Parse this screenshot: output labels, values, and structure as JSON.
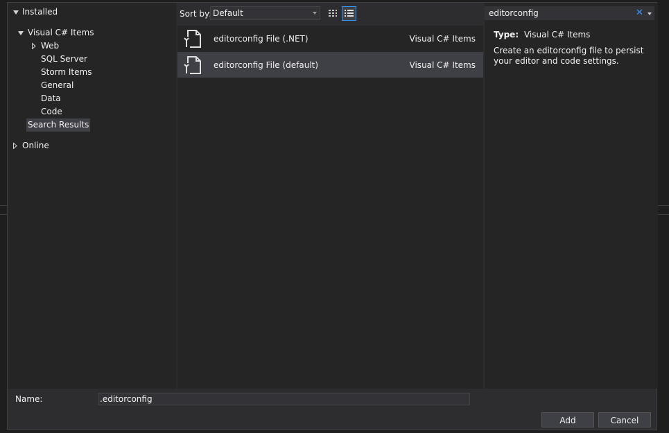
{
  "dialog": {
    "tree": {
      "installed": "Installed",
      "visual_csharp_items": "Visual C# Items",
      "children": [
        "Web",
        "SQL Server",
        "Storm Items",
        "General",
        "Data",
        "Code"
      ],
      "search_results": "Search Results",
      "online": "Online"
    },
    "toolbar": {
      "sort_label": "Sort by:",
      "sort_value": "Default"
    },
    "templates": [
      {
        "name": "editorconfig File (.NET)",
        "category": "Visual C# Items"
      },
      {
        "name": "editorconfig File (default)",
        "category": "Visual C# Items"
      }
    ],
    "search": {
      "value": "editorconfig",
      "clear_glyph": "✕"
    },
    "details": {
      "type_label": "Type:",
      "type_value": "Visual C# Items",
      "description": "Create an editorconfig file to persist your editor and code settings."
    },
    "name_field": {
      "label": "Name:",
      "value": ".editorconfig"
    },
    "buttons": {
      "add": "Add",
      "cancel": "Cancel"
    }
  },
  "colors": {
    "accent": "#3399ff",
    "background": "#2d2d30",
    "panel": "#252526",
    "selection": "#3f3f46"
  }
}
